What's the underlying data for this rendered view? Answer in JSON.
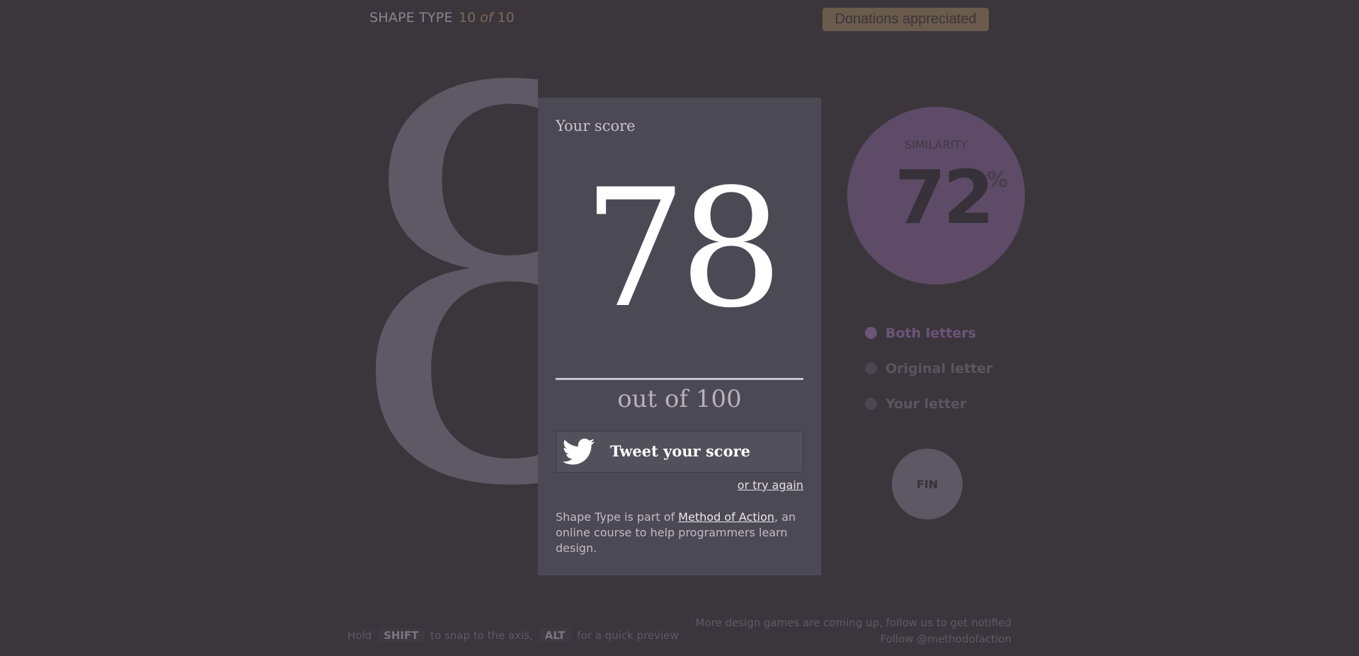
{
  "header": {
    "brand": "SHAPE TYPE",
    "counter_current": "10",
    "counter_of": "of",
    "counter_total": "10",
    "donate_label": "Donations appreciated"
  },
  "glyph": {
    "letter": "8"
  },
  "card": {
    "label": "Your score",
    "score": "78",
    "out_of": "out of 100",
    "tweet_label": "Tweet your score",
    "try_again": "or try again",
    "about_prefix": "Shape Type is part of ",
    "about_link": "Method of Action",
    "about_suffix": ", an online course to help programmers learn design."
  },
  "similarity": {
    "label": "SIMILARITY",
    "value": "72",
    "unit": "%"
  },
  "view_options": {
    "both": "Both letters",
    "original": "Original letter",
    "yours": "Your letter",
    "selected": "both"
  },
  "fin_label": "FIN",
  "footer": {
    "hint_hold": "Hold",
    "key_shift": "SHIFT",
    "hint_snap": "to snap to the axis,",
    "key_alt": "ALT",
    "hint_preview": "for a quick preview",
    "follow_text": "More design games are coming up, follow us to get notified",
    "follow_link": "Follow @methodofaction"
  },
  "colors": {
    "background": "#3b363c",
    "card": "#4b4954",
    "similarity": "#5e4b67",
    "accent": "#6c5577",
    "donate": "#6b5b4c"
  },
  "icons": {
    "tweet": "twitter-bird-icon"
  }
}
